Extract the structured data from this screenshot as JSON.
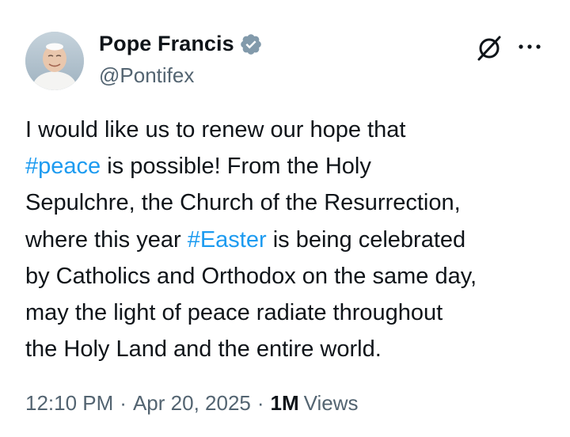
{
  "author": {
    "display_name": "Pope Francis",
    "handle": "@Pontifex",
    "verified": true,
    "verified_badge_color": "#829aab"
  },
  "tweet": {
    "lines": [
      [
        {
          "text": "I would like us to renew our hope that",
          "type": "text"
        }
      ],
      [
        {
          "text": "#peace",
          "type": "hashtag"
        },
        {
          "text": " is possible! From the Holy",
          "type": "text"
        }
      ],
      [
        {
          "text": "Sepulchre, the Church of the Resurrection,",
          "type": "text"
        }
      ],
      [
        {
          "text": "where this year ",
          "type": "text"
        },
        {
          "text": "#Easter",
          "type": "hashtag"
        },
        {
          "text": " is being celebrated",
          "type": "text"
        }
      ],
      [
        {
          "text": "by Catholics and Orthodox on the same day,",
          "type": "text"
        }
      ],
      [
        {
          "text": "may the light of peace radiate throughout",
          "type": "text"
        }
      ],
      [
        {
          "text": "the Holy Land and the entire world.",
          "type": "text"
        }
      ]
    ]
  },
  "meta": {
    "time": "12:10 PM",
    "separator": "·",
    "date": "Apr 20, 2025",
    "views_count": "1M",
    "views_label": "Views"
  },
  "icons": {
    "grok": "grok-icon",
    "more": "more-icon",
    "verified": "verified-badge-icon"
  },
  "colors": {
    "text": "#0f1419",
    "secondary": "#536471",
    "hashtag": "#1d9bf0"
  }
}
